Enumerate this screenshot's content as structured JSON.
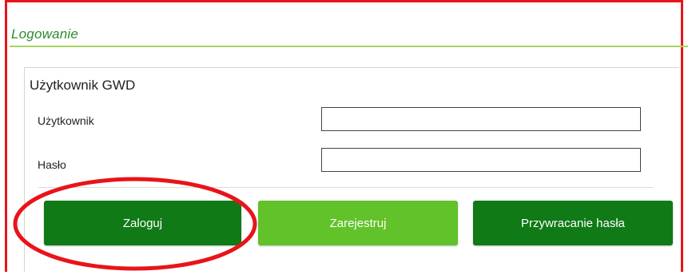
{
  "login_section": {
    "title": "Logowanie",
    "accent_color": "#a8d65e"
  },
  "panel": {
    "title": "Użytkownik GWD",
    "fields": {
      "username": {
        "label": "Użytkownik",
        "value": "",
        "placeholder": ""
      },
      "password": {
        "label": "Hasło",
        "value": "",
        "placeholder": ""
      }
    }
  },
  "buttons": {
    "login": {
      "label": "Zaloguj",
      "color": "#0f7a16"
    },
    "register": {
      "label": "Zarejestruj",
      "color": "#62c22a"
    },
    "password_recovery": {
      "label": "Przywracanie hasła",
      "color": "#0f7a16"
    }
  },
  "annotations": {
    "frame_color": "#e8141a",
    "highlight_target": "login-button"
  }
}
